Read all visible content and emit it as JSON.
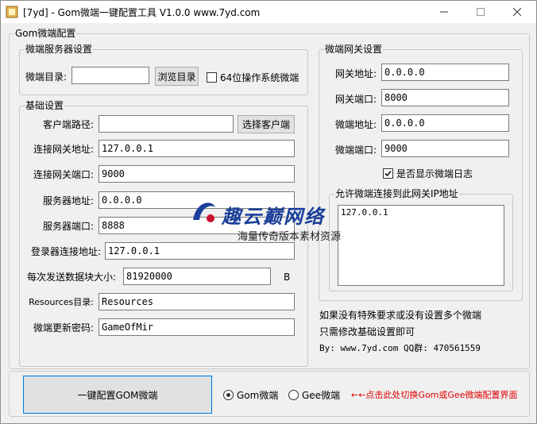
{
  "window": {
    "title": "[7yd] - Gom微端一键配置工具 V1.0.0  www.7yd.com",
    "min_icon": "minimize-icon",
    "max_icon": "maximize-icon",
    "close_icon": "close-icon",
    "icon": "app-icon"
  },
  "gom_group": {
    "legend": "Gom微端配置",
    "server": {
      "legend": "微端服务器设置",
      "dir_label": "微端目录:",
      "dir_value": "",
      "browse_label": "浏览目录",
      "x64_label": "64位操作系统微端",
      "x64_checked": false
    },
    "basic": {
      "legend": "基础设置",
      "client_path_label": "客户端路径:",
      "client_path_value": "",
      "select_client_label": "选择客户端",
      "gate_addr_label": "连接网关地址:",
      "gate_addr_value": "127.0.0.1",
      "gate_port_label": "连接网关端口:",
      "gate_port_value": "9000",
      "server_addr_label": "服务器地址:",
      "server_addr_value": "0.0.0.0",
      "server_port_label": "服务器端口:",
      "server_port_value": "8888",
      "login_addr_label": "登录器连接地址:",
      "login_addr_value": "127.0.0.1",
      "block_size_label": "每次发送数据块大小:",
      "block_size_value": "81920000",
      "block_size_unit": "B",
      "resources_label": "Resources目录:",
      "resources_value": "Resources",
      "update_pwd_label": "微端更新密码:",
      "update_pwd_value": "GameOfMir"
    }
  },
  "gateway": {
    "legend": "微端网关设置",
    "gw_addr_label": "网关地址:",
    "gw_addr_value": "0.0.0.0",
    "gw_port_label": "网关端口:",
    "gw_port_value": "8000",
    "mc_addr_label": "微端地址:",
    "mc_addr_value": "0.0.0.0",
    "mc_port_label": "微端端口:",
    "mc_port_value": "9000",
    "show_log_label": "是否显示微端日志",
    "show_log_checked": true,
    "allowed_legend": "允许微端连接到此网关IP地址",
    "allowed_ips": "127.0.0.1"
  },
  "notes": {
    "line1": "如果没有特殊要求或没有设置多个微端",
    "line2": "只需修改基础设置即可",
    "by": "By: www.7yd.com  QQ群: 470561559"
  },
  "bottom": {
    "main_button": "一键配置GOM微端",
    "mode_options": [
      "Gom微端",
      "Gee微端"
    ],
    "selected_mode": "Gom微端",
    "hint": "←←点击此处切换Gom或Gee微端配置界面",
    "hint_color": "#e00000"
  },
  "watermark": {
    "title": "趣云巅网络",
    "subtitle": "海量传奇版本素材资源"
  }
}
